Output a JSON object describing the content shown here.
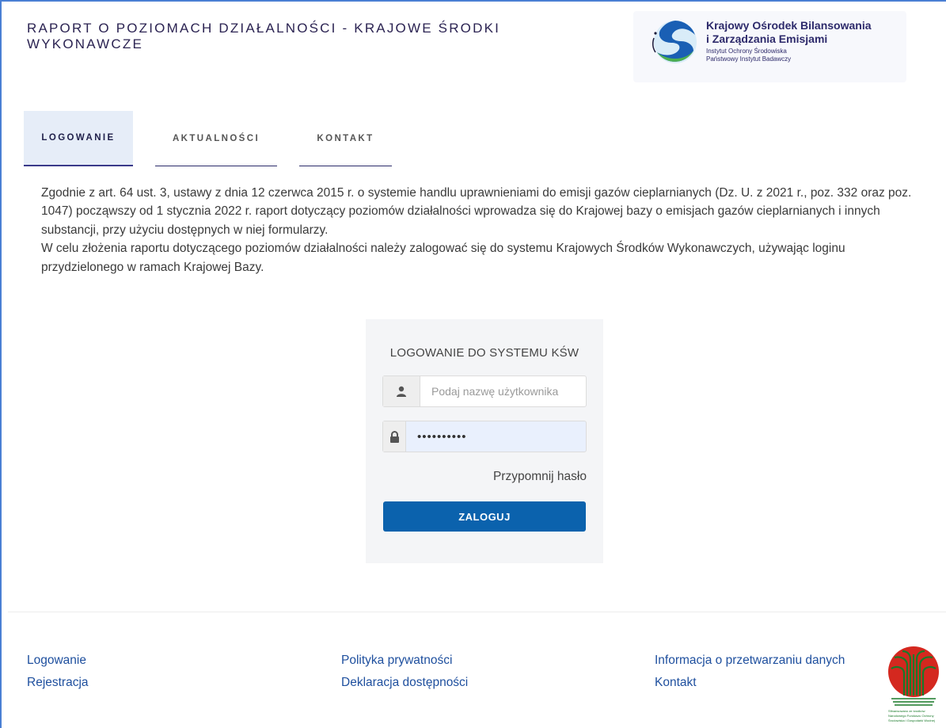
{
  "header": {
    "title": "RAPORT O POZIOMACH DZIAŁALNOŚCI - KRAJOWE ŚRODKI WYKONAWCZE",
    "logo": {
      "line1": "Krajowy Ośrodek Bilansowania",
      "line2": "i Zarządzania Emisjami",
      "line3": "Instytut Ochrony Środowiska",
      "line4": "Państwowy Instytut Badawczy"
    }
  },
  "tabs": [
    {
      "label": "LOGOWANIE",
      "active": true
    },
    {
      "label": "AKTUALNOŚCI",
      "active": false
    },
    {
      "label": "KONTAKT",
      "active": false
    }
  ],
  "intro": {
    "paragraph1": "Zgodnie z art. 64 ust. 3, ustawy z dnia 12 czerwca 2015 r. o systemie handlu uprawnieniami do emisji gazów cieplarnianych (Dz. U. z 2021 r., poz. 332 oraz poz. 1047) począwszy od 1 stycznia 2022 r. raport dotyczący poziomów działalności wprowadza się do Krajowej bazy o emisjach gazów cieplarnianych i innych substancji, przy użyciu dostępnych w niej formularzy.",
    "paragraph2": "W celu złożenia raportu dotyczącego poziomów działalności należy zalogować się do systemu Krajowych Środków Wykonawczych, używając loginu przydzielonego w ramach Krajowej Bazy."
  },
  "login": {
    "title": "LOGOWANIE DO SYSTEMU KŚW",
    "username_placeholder": "Podaj nazwę użytkownika",
    "username_value": "",
    "password_value": "••••••••••",
    "remind_label": "Przypomnij hasło",
    "submit_label": "ZALOGUJ",
    "icons": {
      "user": "user-icon",
      "password": "lock-icon"
    }
  },
  "footer": {
    "col1": [
      "Logowanie",
      "Rejestracja"
    ],
    "col2": [
      "Polityka prywatności",
      "Deklaracja dostępności"
    ],
    "col3": [
      "Informacja o przetwarzaniu danych",
      "Kontakt"
    ],
    "fund_logo_text": "Sfinansowano ze środków Narodowego Funduszu Ochrony Środowiska i Gospodarki Wodnej"
  },
  "colors": {
    "accent": "#0b62ad",
    "link": "#1e4f9e",
    "title": "#2b2352",
    "frame": "#4a7fd4"
  }
}
